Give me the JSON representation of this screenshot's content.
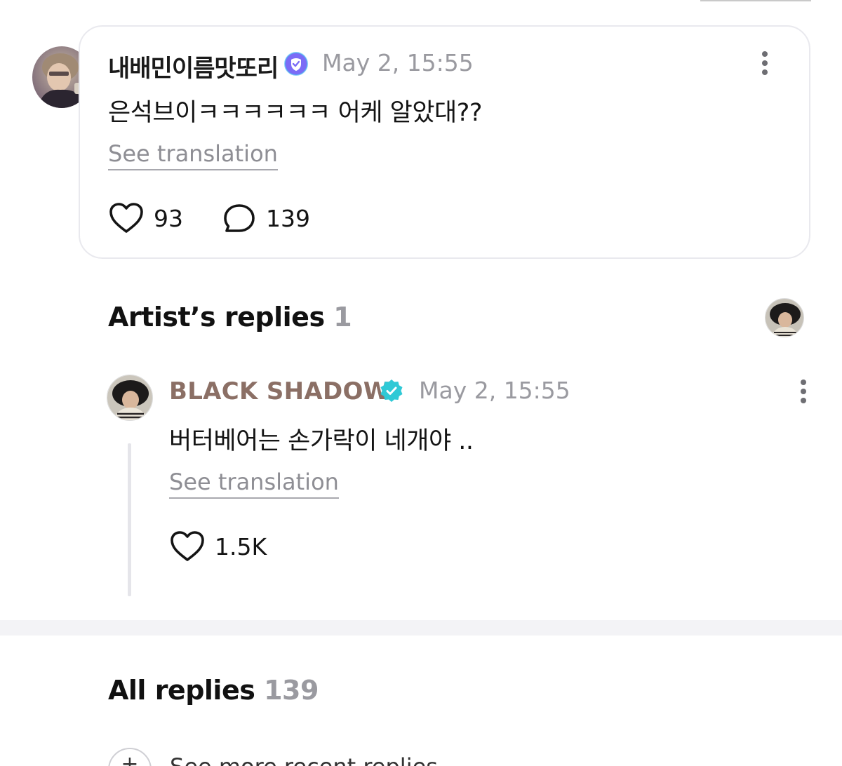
{
  "post": {
    "author": "내배민이름맛또리",
    "verified_icon": "verified-badge-purple",
    "timestamp": "May 2, 15:55",
    "body": "은석브이ㅋㅋㅋㅋㅋㅋ 어케 알았대??",
    "translate_label": "See translation",
    "like_count": "93",
    "reply_count": "139"
  },
  "artist_replies": {
    "title": "Artist’s replies",
    "count": "1",
    "reply": {
      "author": "BLACK SHADOW",
      "verified_icon": "verified-badge-teal",
      "timestamp": "May 2, 15:55",
      "body": "버터베어는 손가락이 네개야 ..",
      "translate_label": "See translation",
      "like_count": "1.5K"
    }
  },
  "all_replies": {
    "title": "All replies",
    "count": "139",
    "see_more_label": "See more recent replies"
  },
  "colors": {
    "artist_name": "#8b6f65",
    "muted_text": "#9a9aa0",
    "verified_purple": "#7b6cf6",
    "verified_teal": "#2fc9d6",
    "card_border": "#e9e9ee",
    "divider": "#f3f3f6"
  }
}
